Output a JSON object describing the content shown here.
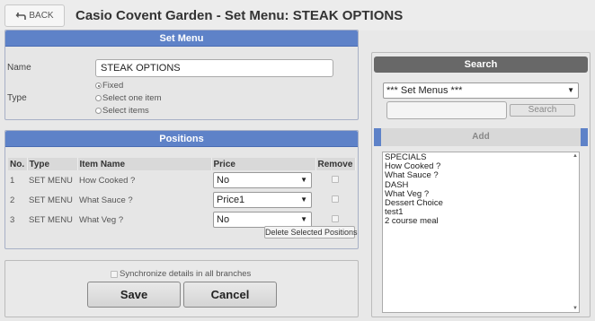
{
  "header": {
    "back_label": "BACK",
    "title": "Casio Covent Garden - Set Menu: STEAK OPTIONS"
  },
  "set_menu": {
    "title": "Set Menu",
    "name_label": "Name",
    "name_value": "STEAK OPTIONS",
    "type_label": "Type",
    "type_options": [
      {
        "label": "Fixed",
        "selected": true
      },
      {
        "label": "Select one item",
        "selected": false
      },
      {
        "label": "Select items",
        "selected": false
      }
    ]
  },
  "positions": {
    "title": "Positions",
    "columns": [
      "No.",
      "Type",
      "Item Name",
      "Price",
      "Remove"
    ],
    "rows": [
      {
        "no": "1",
        "type": "SET MENU",
        "item": "How Cooked ?",
        "price": "No",
        "remove": false
      },
      {
        "no": "2",
        "type": "SET MENU",
        "item": "What Sauce ?",
        "price": "Price1",
        "remove": false
      },
      {
        "no": "3",
        "type": "SET MENU",
        "item": "What Veg ?",
        "price": "No",
        "remove": false
      }
    ],
    "delete_label": "Delete Selected Positions"
  },
  "footer": {
    "sync_label": "Synchronize details in all branches",
    "save_label": "Save",
    "cancel_label": "Cancel"
  },
  "search": {
    "title": "Search",
    "menu_value": "*** Set Menus ***",
    "search_placeholder": "",
    "search_button": "Search",
    "add_label": "Add",
    "items": [
      "SPECIALS",
      "How Cooked ?",
      "What Sauce ?",
      "DASH",
      "What Veg ?",
      "Dessert Choice",
      "test1",
      "2 course meal"
    ]
  },
  "colors": {
    "panel_header": "#5e82c8",
    "search_header": "#686868",
    "background": "#e8e8e8"
  }
}
